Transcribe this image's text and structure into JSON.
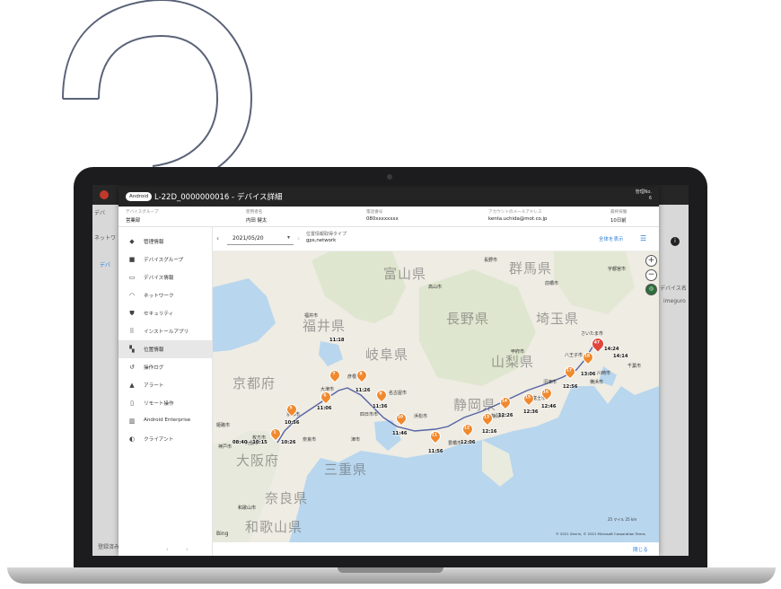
{
  "header": {
    "os_chip": "Android",
    "title": "L-22D_0000000016 - デバイス詳細",
    "mgmt_label": "管理No.",
    "mgmt_value": "6"
  },
  "info": {
    "group_label": "デバイスグループ",
    "group_value": "営業部",
    "user_label": "使用者名",
    "user_value": "内田 健太",
    "phone_label": "電話番号",
    "phone_value": "080xxxxxxxx",
    "mail_label": "アカウントのメールアドレス",
    "mail_value": "kenta.uchida@mot.co.jp",
    "last_label": "最終稼働",
    "last_value": "10日前"
  },
  "sidebar": {
    "items": [
      {
        "label": "管理情報",
        "icon": "tag-icon"
      },
      {
        "label": "デバイスグループ",
        "icon": "folder-icon"
      },
      {
        "label": "デバイス情報",
        "icon": "devices-icon"
      },
      {
        "label": "ネットワーク",
        "icon": "wifi-icon"
      },
      {
        "label": "セキュリティ",
        "icon": "shield-icon"
      },
      {
        "label": "インストールアプリ",
        "icon": "apps-grid-icon"
      },
      {
        "label": "位置情報",
        "icon": "map-icon"
      },
      {
        "label": "操作ログ",
        "icon": "history-icon"
      },
      {
        "label": "アラート",
        "icon": "alert-icon"
      },
      {
        "label": "リモート操作",
        "icon": "remote-icon"
      },
      {
        "label": "Android Enterprise",
        "icon": "building-icon"
      },
      {
        "label": "クライアント",
        "icon": "client-icon"
      }
    ],
    "active": "位置情報"
  },
  "toolbar": {
    "date": "2021/05/20",
    "loc_type_label": "位置情報取得タイプ",
    "loc_type_value": "gps,network",
    "show_all": "全体を表示"
  },
  "map": {
    "prefectures": [
      "富山県",
      "群馬県",
      "長野県",
      "福井県",
      "岐阜県",
      "埼玉県",
      "山梨県",
      "京都府",
      "静岡県",
      "大阪府",
      "三重県",
      "奈良県",
      "和歌山県"
    ],
    "cities": [
      "長野市",
      "前橋市",
      "宇都宮市",
      "福井市",
      "高山市",
      "甲府市",
      "さいたま市",
      "豊橋市",
      "横浜市",
      "川崎市",
      "千葉市",
      "名古屋市",
      "京都市",
      "大津市",
      "奈良市",
      "浜松市",
      "静岡市",
      "富士市",
      "沼津市",
      "八王子市",
      "彦根市",
      "四日市市",
      "津市",
      "枚方市",
      "和歌山市",
      "大阪市",
      "神戸市",
      "姫路市"
    ],
    "times": [
      "11:18",
      "11:26",
      "11:06",
      "10:56",
      "11:36",
      "08:40 - 10:15",
      "10:26",
      "11:46",
      "11:56",
      "12:06",
      "12:16",
      "12:26",
      "12:36",
      "12:46",
      "12:56",
      "13:06",
      "14:24",
      "14:14"
    ],
    "pins": [
      "1",
      "5",
      "6",
      "7",
      "8",
      "9",
      "10",
      "11",
      "12",
      "13",
      "14",
      "15",
      "16",
      "17",
      "18",
      "47"
    ],
    "bing": "Bing",
    "copyright": "© 2021 Zenrin, © 2021 Microsoft Corporation  Terms",
    "scale": "25 マイル      25 km"
  },
  "footer": {
    "close": "閉じる"
  },
  "background_app": {
    "tab": "デバ",
    "network": "ネットワ",
    "devi": "デバ",
    "reg": "登録済み",
    "right1": "デバイス名",
    "right2": "imeguro"
  }
}
